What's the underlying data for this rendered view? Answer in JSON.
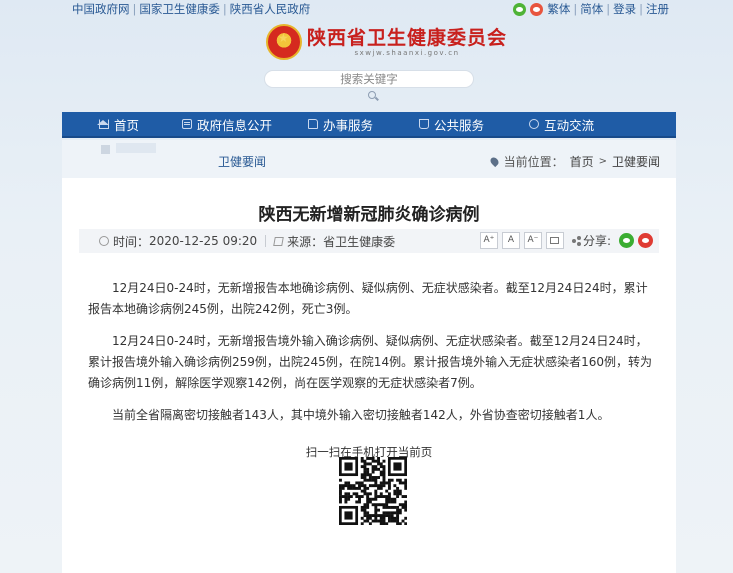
{
  "topbar": {
    "links": [
      "中国政府网",
      "国家卫生健康委",
      "陕西省人民政府"
    ],
    "user_links": [
      "繁体",
      "简体",
      "登录",
      "注册"
    ]
  },
  "header": {
    "title": "陕西省卫生健康委员会",
    "domain": "sxwjw.shaanxi.gov.cn"
  },
  "search": {
    "placeholder": "搜索关键字"
  },
  "nav": {
    "items": [
      {
        "label": "首页",
        "icon": "home-icon"
      },
      {
        "label": "政府信息公开",
        "icon": "document-icon"
      },
      {
        "label": "办事服务",
        "icon": "folder-icon"
      },
      {
        "label": "公共服务",
        "icon": "cart-icon"
      },
      {
        "label": "互动交流",
        "icon": "chat-icon"
      }
    ]
  },
  "section": {
    "tab": "卫健要闻",
    "location_label": "当前位置：",
    "crumbs": [
      "首页",
      "卫健要闻"
    ]
  },
  "article": {
    "title": "陕西无新增新冠肺炎确诊病例",
    "time_label": "时间：",
    "time": "2020-12-25 09:20",
    "source_label": "来源：",
    "source": "省卫生健康委",
    "font_buttons": [
      "A⁺",
      "A",
      "A⁻"
    ],
    "share_label": "分享:",
    "paragraphs": [
      "12月24日0-24时，无新增报告本地确诊病例、疑似病例、无症状感染者。截至12月24日24时，累计报告本地确诊病例245例，出院242例，死亡3例。",
      "12月24日0-24时，无新增报告境外输入确诊病例、疑似病例、无症状感染者。截至12月24日24时，累计报告境外输入确诊病例259例，出院245例，在院14例。累计报告境外输入无症状感染者160例，转为确诊病例11例，解除医学观察142例，尚在医学观察的无症状感染者7例。",
      "当前全省隔离密切接触者143人，其中境外输入密切接触者142人，外省协查密切接触者1人。"
    ],
    "qr_label": "扫一扫在手机打开当前页"
  },
  "colors": {
    "nav_blue": "#1f5ca6",
    "title_red": "#c8201d",
    "link_blue": "#2a5a94"
  }
}
